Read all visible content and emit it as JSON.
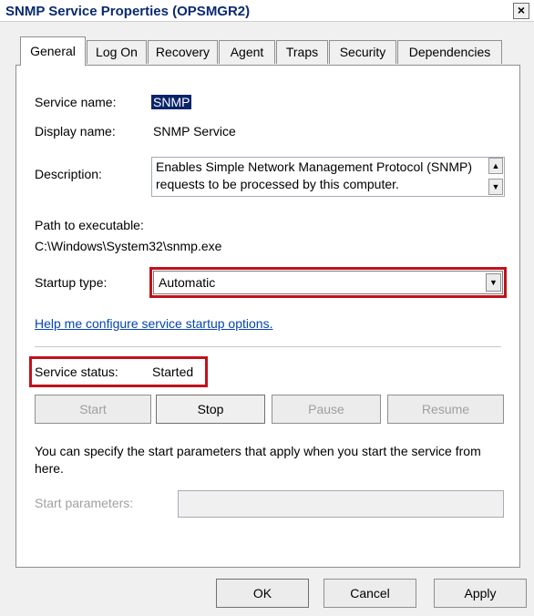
{
  "window": {
    "title": "SNMP Service Properties (OPSMGR2)",
    "close_glyph": "×"
  },
  "tabs": [
    "General",
    "Log On",
    "Recovery",
    "Agent",
    "Traps",
    "Security",
    "Dependencies"
  ],
  "general": {
    "service_name_label": "Service name:",
    "service_name_value": "SNMP",
    "display_name_label": "Display name:",
    "display_name_value": "SNMP Service",
    "description_label": "Description:",
    "description_text": "Enables Simple Network Management Protocol (SNMP) requests to be processed by this computer.",
    "path_label": "Path to executable:",
    "path_value": "C:\\Windows\\System32\\snmp.exe",
    "startup_type_label": "Startup type:",
    "startup_type_value": "Automatic",
    "help_link": "Help me configure service startup options.",
    "service_status_label": "Service status:",
    "service_status_value": "Started",
    "buttons": {
      "start": "Start",
      "stop": "Stop",
      "pause": "Pause",
      "resume": "Resume"
    },
    "start_params_note": "You can specify the start parameters that apply when you start the service from here.",
    "start_params_label": "Start parameters:",
    "start_params_value": ""
  },
  "footer": {
    "ok": "OK",
    "cancel": "Cancel",
    "apply": "Apply"
  },
  "colors": {
    "highlight": "#c0121c",
    "selection": "#0a246a",
    "link": "#0645ad"
  }
}
